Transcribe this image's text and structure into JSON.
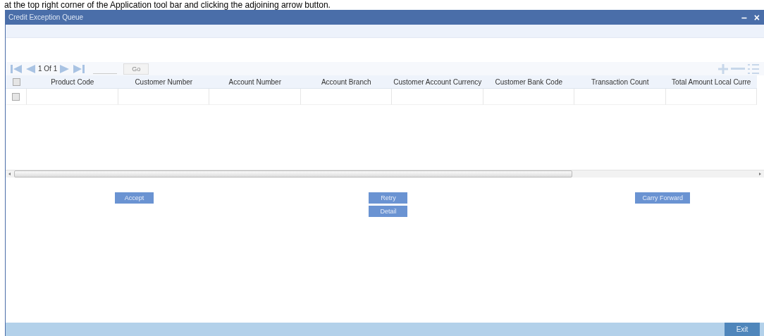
{
  "caption": "at the top right corner of the Application tool bar and clicking the adjoining arrow button.",
  "window": {
    "title": "Credit Exception Queue",
    "controls": [
      "–",
      "×"
    ]
  },
  "pager": {
    "text": "1 Of 1",
    "go": "Go"
  },
  "table": {
    "select_all": {
      "checked": false
    },
    "columns": [
      "Product Code",
      "Customer Number",
      "Account Number",
      "Account Branch",
      "Customer Account Currency",
      "Customer Bank Code",
      "Transaction Count",
      "Total Amount Local Curre"
    ],
    "rows": [
      {
        "checked": false
      }
    ]
  },
  "button_groups": [
    [
      "Accept"
    ],
    [
      "Retry",
      "Detail"
    ],
    [
      "Carry Forward"
    ]
  ],
  "footer": {
    "exit": "Exit"
  }
}
